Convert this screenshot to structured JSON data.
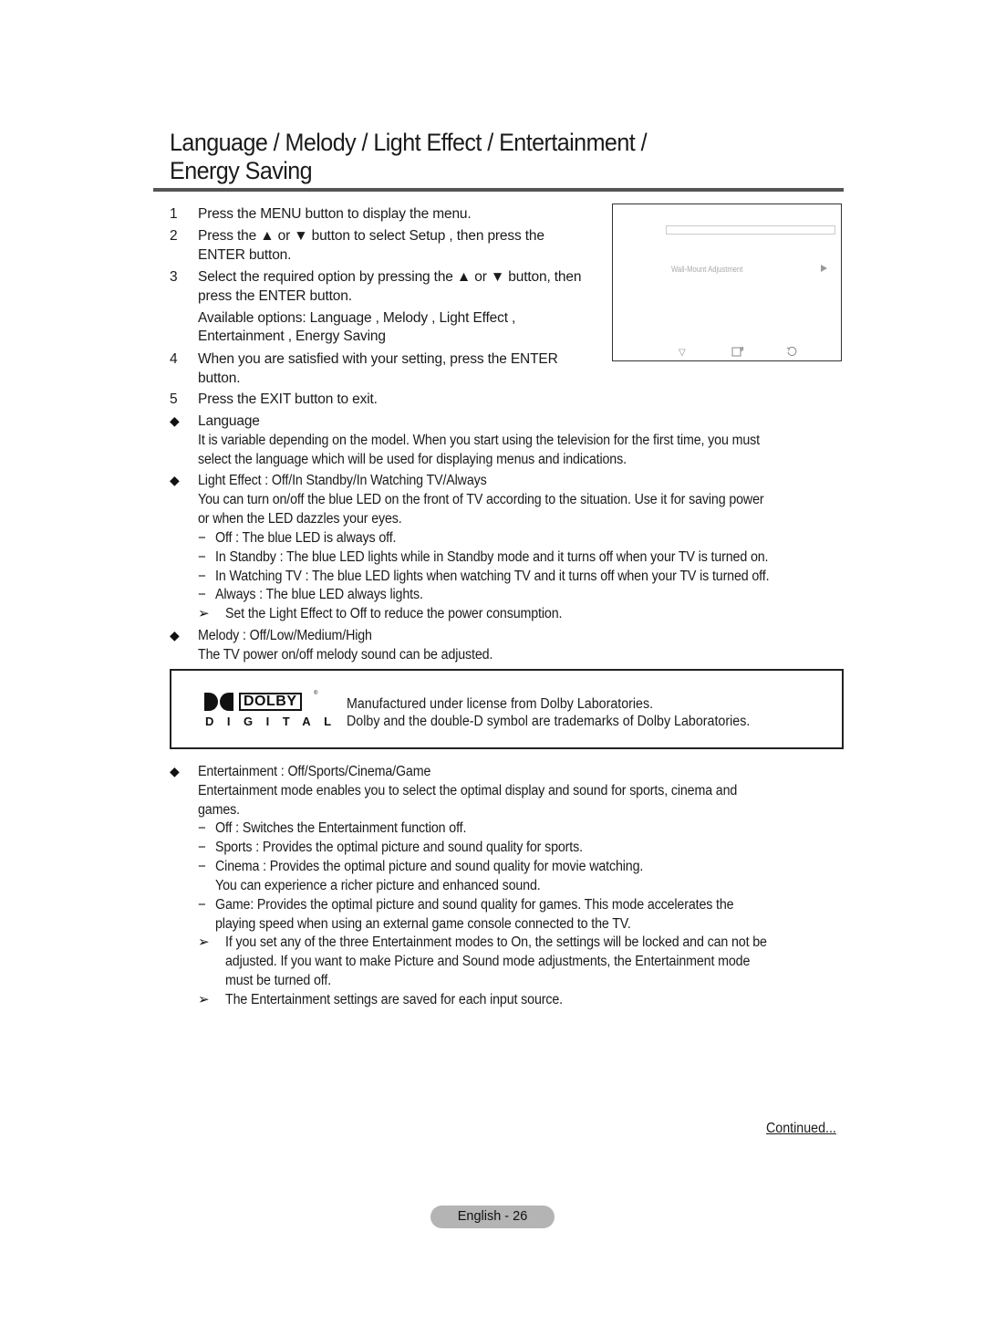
{
  "page": {
    "title_line1": "Language / Melody / Light Effect / Entertainment /",
    "title_line2": "Energy Saving"
  },
  "steps": [
    {
      "num": "1",
      "lines": [
        "Press the MENU button to display the menu."
      ]
    },
    {
      "num": "2",
      "lines": [
        "Press the ▲ or ▼ button to select Setup , then press the",
        "ENTER button."
      ]
    },
    {
      "num": "3",
      "lines": [
        "Select the required option by pressing the ▲ or ▼ button, then",
        "press the ENTER button."
      ]
    },
    {
      "num": "",
      "lines": [
        "Available options: Language , Melody , Light Effect  ,",
        "Entertainment  , Energy Saving"
      ]
    },
    {
      "num": "4",
      "lines": [
        "When you are satisfied with your setting, press the ENTER",
        "button."
      ]
    },
    {
      "num": "5",
      "lines": [
        "Press the EXIT button to exit."
      ]
    }
  ],
  "tv_screen": {
    "menu_item": "Wall-Mount Adjustment",
    "icons": [
      "move-icon",
      "enter-icon",
      "return-icon"
    ]
  },
  "sections": {
    "language": {
      "heading": "Language",
      "body": [
        "It is variable depending on the model. When you start using the television for the first time, you must",
        "select the language which will be used for displaying menus and indications."
      ]
    },
    "light_effect": {
      "heading": "Light Effect  : Off/In Standby/In Watching TV/Always",
      "body": [
        "You can turn on/off the blue LED on the front of TV according to the situation. Use it for saving power",
        "or when the LED dazzles your eyes."
      ],
      "options": [
        "Off : The blue LED is always off.",
        "In Standby : The blue LED lights while in Standby mode and it turns off when your TV is turned on.",
        "In Watching TV : The blue LED lights when watching TV and it turns off when your TV is turned off.",
        "Always : The blue LED always lights."
      ],
      "note": "Set the Light Effect to Off to reduce the power consumption."
    },
    "melody": {
      "heading": "Melody : Off/Low/Medium/High",
      "body": "The TV power on/off melody sound can be adjusted."
    },
    "dolby": {
      "logo_word": "DOLBY",
      "logo_sub": "DIGITAL",
      "line1": "Manufactured under license from Dolby Laboratories.",
      "line2": "Dolby and the double-D symbol are trademarks of Dolby Laboratories."
    },
    "entertainment": {
      "heading": "Entertainment  : Off/Sports/Cinema/Game",
      "body": [
        "Entertainment mode enables you to select the optimal display and sound for sports, cinema and",
        "games."
      ],
      "options": [
        [
          "Off : Switches the Entertainment   function off."
        ],
        [
          "Sports : Provides the optimal picture and sound quality for sports."
        ],
        [
          "Cinema : Provides the optimal picture and sound quality for movie watching.",
          "You can experience a richer picture and enhanced sound."
        ],
        [
          "Game: Provides the optimal picture and sound quality for games. This mode accelerates the",
          "playing speed when using an external game console connected to the TV."
        ]
      ],
      "notes": [
        [
          "If you set any of the three Entertainment modes to On, the settings will be locked and can not be",
          "adjusted. If you want to make Picture and Sound mode adjustments, the Entertainment mode",
          "must be turned off."
        ],
        [
          "The Entertainment settings are saved for each input source."
        ]
      ]
    }
  },
  "footer": {
    "continued": "Continued...",
    "page_label": "English - 26"
  }
}
